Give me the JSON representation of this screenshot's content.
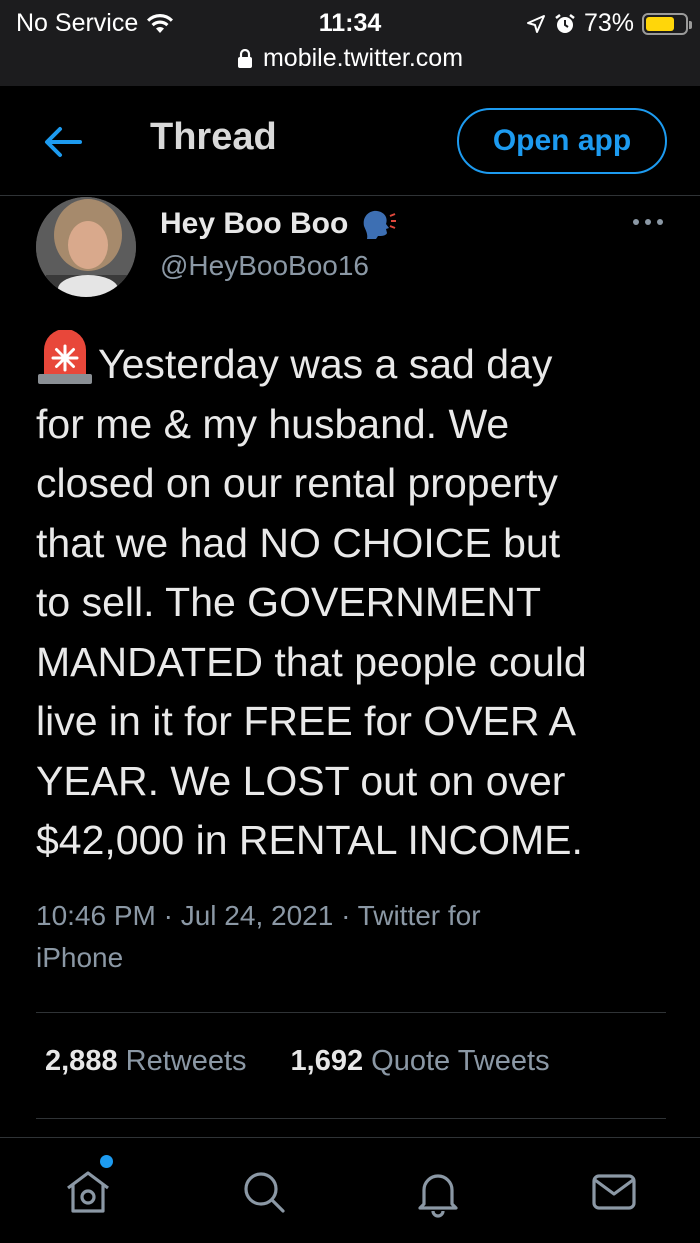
{
  "status_bar": {
    "carrier": "No Service",
    "time": "11:34",
    "battery": "73%",
    "battery_level": 0.73,
    "url": "mobile.twitter.com",
    "battery_color": "#ffd60a"
  },
  "header": {
    "title": "Thread",
    "open_app_label": "Open app",
    "accent_color": "#1d9bf0"
  },
  "tweet": {
    "display_name": "Hey Boo Boo",
    "name_emoji_icon": "speaking-head-icon",
    "handle": "@HeyBooBoo16",
    "lead_emoji_icon": "police-siren-icon",
    "text_lines": [
      "Yesterday was a sad day",
      "for me & my husband. We",
      "closed on our rental property",
      "that we had NO CHOICE but",
      "to sell. The GOVERNMENT",
      "MANDATED that people could",
      "live in it for FREE for OVER A",
      "YEAR. We LOST out on over",
      "$42,000 in RENTAL INCOME."
    ],
    "meta_line1": "10:46 PM · Jul 24, 2021 · Twitter for",
    "meta_line2": "iPhone",
    "retweets_count": "2,888",
    "retweets_label": "Retweets",
    "quote_count": "1,692",
    "quote_label": "Quote Tweets"
  },
  "bottom_nav": {
    "items": [
      "home-icon",
      "search-icon",
      "notifications-icon",
      "messages-icon"
    ],
    "has_notification_dot": true
  }
}
